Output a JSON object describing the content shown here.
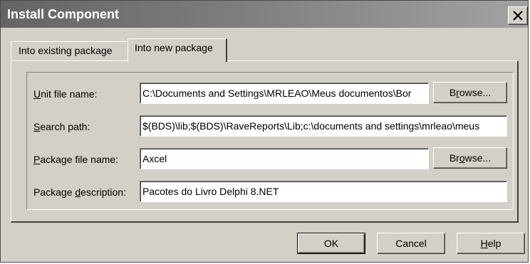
{
  "window": {
    "title": "Install Component",
    "close_glyph": "close-icon"
  },
  "tabs": [
    {
      "label": "Into existing package",
      "selected": false
    },
    {
      "label": "Into new package",
      "selected": true
    }
  ],
  "form": {
    "unit_file": {
      "label_access": "U",
      "label_rest": "nit file name:",
      "value": "C:\\Documents and Settings\\MRLEAO\\Meus documentos\\Bor",
      "browse_label_pre": "B",
      "browse_label_access": "r",
      "browse_label_post": "owse..."
    },
    "search_path": {
      "label_access": "S",
      "label_rest": "earch path:",
      "value": "$(BDS)\\lib;$(BDS)\\RaveReports\\Lib;c:\\documents and settings\\mrleao\\meus"
    },
    "package_file": {
      "label_access": "P",
      "label_rest": "ackage file name:",
      "value": "Axcel",
      "browse_label_pre": "Br",
      "browse_label_access": "o",
      "browse_label_post": "wse..."
    },
    "package_description": {
      "label_pre": "Package ",
      "label_access": "d",
      "label_rest": "escription:",
      "value": "Pacotes do Livro Delphi 8.NET"
    }
  },
  "footer": {
    "ok_label": "OK",
    "cancel_label": "Cancel",
    "help_access": "H",
    "help_rest": "elp"
  }
}
